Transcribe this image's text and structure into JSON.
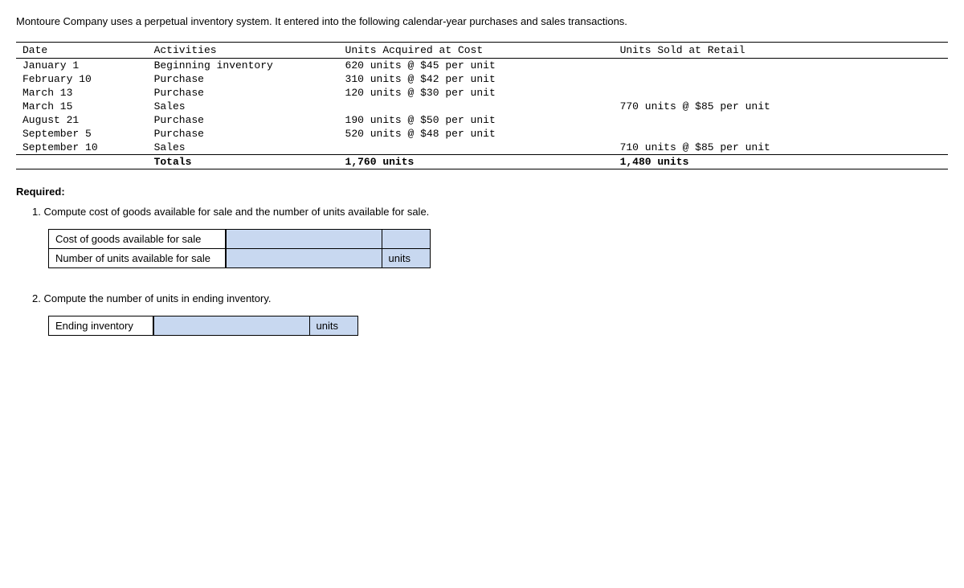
{
  "intro": "Montoure Company uses a perpetual inventory system. It entered into the following calendar-year purchases and sales transactions.",
  "table": {
    "headers": {
      "date": "Date",
      "activities": "Activities",
      "acquired": "Units Acquired at Cost",
      "sold": "Units Sold at Retail"
    },
    "rows": [
      {
        "date": "January 1",
        "activity": "Beginning inventory",
        "acquired": "620 units  @ $45 per unit",
        "sold": ""
      },
      {
        "date": "February 10",
        "activity": "Purchase",
        "acquired": "310 units  @ $42 per unit",
        "sold": ""
      },
      {
        "date": "March 13",
        "activity": "Purchase",
        "acquired": "120 units  @ $30 per unit",
        "sold": ""
      },
      {
        "date": "March 15",
        "activity": "Sales",
        "acquired": "",
        "sold": "770 units @ $85 per unit"
      },
      {
        "date": "August 21",
        "activity": "Purchase",
        "acquired": "190 units  @ $50 per unit",
        "sold": ""
      },
      {
        "date": "September 5",
        "activity": "Purchase",
        "acquired": "520 units  @ $48 per unit",
        "sold": ""
      },
      {
        "date": "September 10",
        "activity": "Sales",
        "acquired": "",
        "sold": "710 units @ $85 per unit"
      }
    ],
    "totals": {
      "label": "Totals",
      "acquired": "1,760 units",
      "sold": "1,480 units"
    }
  },
  "required_label": "Required:",
  "question1": {
    "text": "1. Compute cost of goods available for sale and the number of units available for sale.",
    "rows": [
      {
        "label": "Cost of goods available for sale",
        "input": "",
        "unit": ""
      },
      {
        "label": "Number of units available for sale",
        "input": "",
        "unit": "units"
      }
    ]
  },
  "question2": {
    "text": "2. Compute the number of units in ending inventory.",
    "row": {
      "label": "Ending inventory",
      "input": "",
      "unit": "units"
    }
  }
}
